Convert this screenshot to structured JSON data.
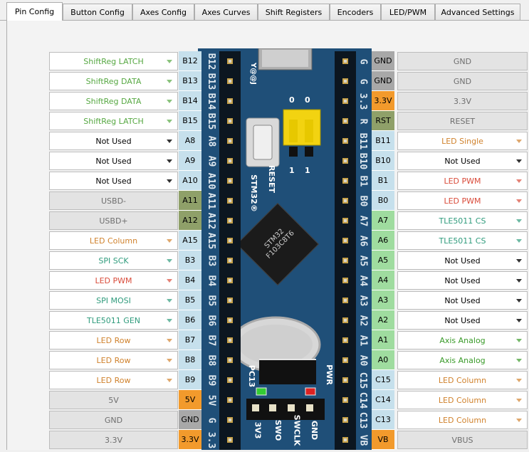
{
  "tabs": [
    "Pin Config",
    "Button Config",
    "Axes Config",
    "Axes Curves",
    "Shift Registers",
    "Encoders",
    "LED/PWM",
    "Advanced Settings"
  ],
  "board": {
    "top_text": "Y@@J",
    "reset": "RESET",
    "stm": "STM32®",
    "chip": "STM32 F103C8T6",
    "jumper_top": [
      "0",
      "0"
    ],
    "jumper_bottom": [
      "1",
      "1"
    ],
    "pc13": "PC13",
    "pwr": "PWR",
    "bottom_pins": [
      "3V3",
      "SWO",
      "SWCLK",
      "GND"
    ]
  },
  "left": [
    {
      "v": "ShiftReg LATCH",
      "c": "#57a843",
      "pin": "B12",
      "bg": "#c6e0ec",
      "dis": false
    },
    {
      "v": "ShiftReg DATA",
      "c": "#57a843",
      "pin": "B13",
      "bg": "#c6e0ec",
      "dis": false
    },
    {
      "v": "ShiftReg DATA",
      "c": "#57a843",
      "pin": "B14",
      "bg": "#c6e0ec",
      "dis": false
    },
    {
      "v": "ShiftReg LATCH",
      "c": "#57a843",
      "pin": "B15",
      "bg": "#c6e0ec",
      "dis": false
    },
    {
      "v": "Not Used",
      "c": "#000000",
      "pin": "A8",
      "bg": "#c6e0ec",
      "dis": false
    },
    {
      "v": "Not Used",
      "c": "#000000",
      "pin": "A9",
      "bg": "#c6e0ec",
      "dis": false
    },
    {
      "v": "Not Used",
      "c": "#000000",
      "pin": "A10",
      "bg": "#c6e0ec",
      "dis": false
    },
    {
      "v": "USBD-",
      "c": "#6f6f6f",
      "pin": "A11",
      "bg": "#8fa069",
      "dis": true
    },
    {
      "v": "USBD+",
      "c": "#6f6f6f",
      "pin": "A12",
      "bg": "#8fa069",
      "dis": true
    },
    {
      "v": "LED Column",
      "c": "#d0822d",
      "pin": "A15",
      "bg": "#c6e0ec",
      "dis": false
    },
    {
      "v": "SPI SCK",
      "c": "#2f9b7c",
      "pin": "B3",
      "bg": "#c6e0ec",
      "dis": false
    },
    {
      "v": "LED PWM",
      "c": "#d94b3a",
      "pin": "B4",
      "bg": "#c6e0ec",
      "dis": false
    },
    {
      "v": "SPI MOSI",
      "c": "#2f9b7c",
      "pin": "B5",
      "bg": "#c6e0ec",
      "dis": false
    },
    {
      "v": "TLE5011 GEN",
      "c": "#2f9b7c",
      "pin": "B6",
      "bg": "#c6e0ec",
      "dis": false
    },
    {
      "v": "LED Row",
      "c": "#d0822d",
      "pin": "B7",
      "bg": "#c6e0ec",
      "dis": false
    },
    {
      "v": "LED Row",
      "c": "#d0822d",
      "pin": "B8",
      "bg": "#c6e0ec",
      "dis": false
    },
    {
      "v": "LED Row",
      "c": "#d0822d",
      "pin": "B9",
      "bg": "#c6e0ec",
      "dis": false
    },
    {
      "v": "5V",
      "c": "#6f6f6f",
      "pin": "5V",
      "bg": "#f29a2c",
      "dis": true
    },
    {
      "v": "GND",
      "c": "#6f6f6f",
      "pin": "GND",
      "bg": "#a8a8a8",
      "dis": true
    },
    {
      "v": "3.3V",
      "c": "#6f6f6f",
      "pin": "3.3V",
      "bg": "#f29a2c",
      "dis": true
    }
  ],
  "right": [
    {
      "v": "GND",
      "c": "#6f6f6f",
      "pin": "GND",
      "bg": "#a8a8a8",
      "dis": true
    },
    {
      "v": "GND",
      "c": "#6f6f6f",
      "pin": "GND",
      "bg": "#a8a8a8",
      "dis": true
    },
    {
      "v": "3.3V",
      "c": "#6f6f6f",
      "pin": "3.3V",
      "bg": "#f29a2c",
      "dis": true
    },
    {
      "v": "RESET",
      "c": "#6f6f6f",
      "pin": "RST",
      "bg": "#8fa069",
      "dis": true
    },
    {
      "v": "LED Single",
      "c": "#d0822d",
      "pin": "B11",
      "bg": "#c6e0ec",
      "dis": false
    },
    {
      "v": "Not Used",
      "c": "#000000",
      "pin": "B10",
      "bg": "#c6e0ec",
      "dis": false
    },
    {
      "v": "LED PWM",
      "c": "#d94b3a",
      "pin": "B1",
      "bg": "#c6e0ec",
      "dis": false
    },
    {
      "v": "LED PWM",
      "c": "#d94b3a",
      "pin": "B0",
      "bg": "#c6e0ec",
      "dis": false
    },
    {
      "v": "TLE5011 CS",
      "c": "#2f9b7c",
      "pin": "A7",
      "bg": "#9fdc9f",
      "dis": false
    },
    {
      "v": "TLE5011 CS",
      "c": "#2f9b7c",
      "pin": "A6",
      "bg": "#9fdc9f",
      "dis": false
    },
    {
      "v": "Not Used",
      "c": "#000000",
      "pin": "A5",
      "bg": "#9fdc9f",
      "dis": false
    },
    {
      "v": "Not Used",
      "c": "#000000",
      "pin": "A4",
      "bg": "#9fdc9f",
      "dis": false
    },
    {
      "v": "Not Used",
      "c": "#000000",
      "pin": "A3",
      "bg": "#9fdc9f",
      "dis": false
    },
    {
      "v": "Not Used",
      "c": "#000000",
      "pin": "A2",
      "bg": "#9fdc9f",
      "dis": false
    },
    {
      "v": "Axis Analog",
      "c": "#3a9a2a",
      "pin": "A1",
      "bg": "#9fdc9f",
      "dis": false
    },
    {
      "v": "Axis Analog",
      "c": "#3a9a2a",
      "pin": "A0",
      "bg": "#9fdc9f",
      "dis": false
    },
    {
      "v": "LED Column",
      "c": "#d0822d",
      "pin": "C15",
      "bg": "#c6e0ec",
      "dis": false
    },
    {
      "v": "LED Column",
      "c": "#d0822d",
      "pin": "C14",
      "bg": "#c6e0ec",
      "dis": false
    },
    {
      "v": "LED Column",
      "c": "#d0822d",
      "pin": "C13",
      "bg": "#c6e0ec",
      "dis": false
    },
    {
      "v": "VBUS",
      "c": "#6f6f6f",
      "pin": "VB",
      "bg": "#f29a2c",
      "dis": true
    }
  ],
  "board_left_labels": [
    "B12",
    "B13",
    "B14",
    "B15",
    "A8",
    "A9",
    "A10",
    "A11",
    "A12",
    "A15",
    "B3",
    "B4",
    "B5",
    "B6",
    "B7",
    "B8",
    "B9",
    "5V",
    "G",
    "3.3"
  ],
  "board_right_labels": [
    "G",
    "G",
    "3.3",
    "R",
    "B11",
    "B10",
    "B1",
    "B0",
    "A7",
    "A6",
    "A5",
    "A4",
    "A3",
    "A2",
    "A1",
    "A0",
    "C15",
    "C14",
    "C13",
    "VB"
  ]
}
